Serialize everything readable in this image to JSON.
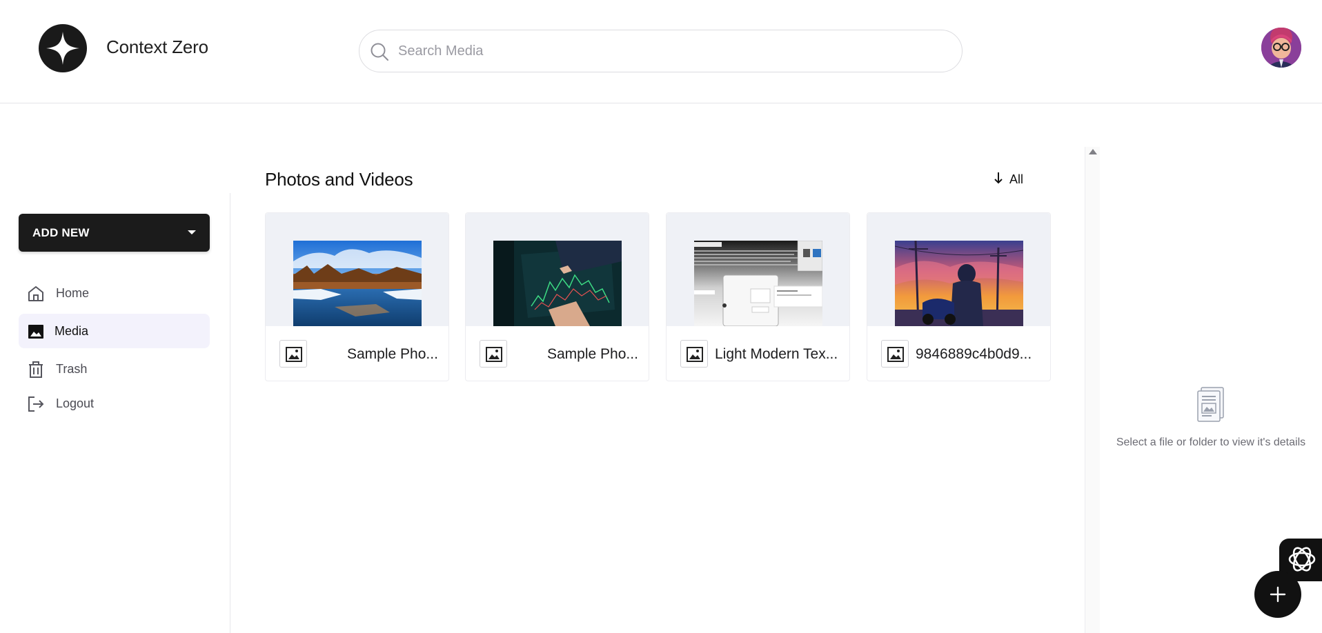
{
  "header": {
    "app_title": "Context Zero",
    "search_placeholder": "Search Media",
    "search_value": ""
  },
  "sidebar": {
    "add_new_label": "ADD NEW",
    "items": [
      {
        "label": "Home",
        "icon": "home-icon",
        "active": false
      },
      {
        "label": "Media",
        "icon": "image-icon",
        "active": true
      },
      {
        "label": "Trash",
        "icon": "trash-icon",
        "active": false
      },
      {
        "label": "Logout",
        "icon": "logout-icon",
        "active": false
      }
    ]
  },
  "main": {
    "section_title": "Photos and Videos",
    "sort_label": "All",
    "files": [
      {
        "name": "Sample Pho...",
        "type": "image",
        "thumbnail": "river-landscape"
      },
      {
        "name": "Sample Pho...",
        "type": "image",
        "thumbnail": "stock-chart"
      },
      {
        "name": "Light Modern Tex...",
        "type": "image",
        "thumbnail": "document-screenshot"
      },
      {
        "name": "9846889c4b0d9...",
        "type": "image",
        "thumbnail": "sunset-illustration"
      }
    ]
  },
  "details": {
    "empty_text": "Select a file or folder to view it's details"
  },
  "colors": {
    "primary": "#111111",
    "active_nav_bg": "#f3f2fc",
    "thumb_bg": "#eff1f6",
    "muted_text": "#6b6b73"
  }
}
